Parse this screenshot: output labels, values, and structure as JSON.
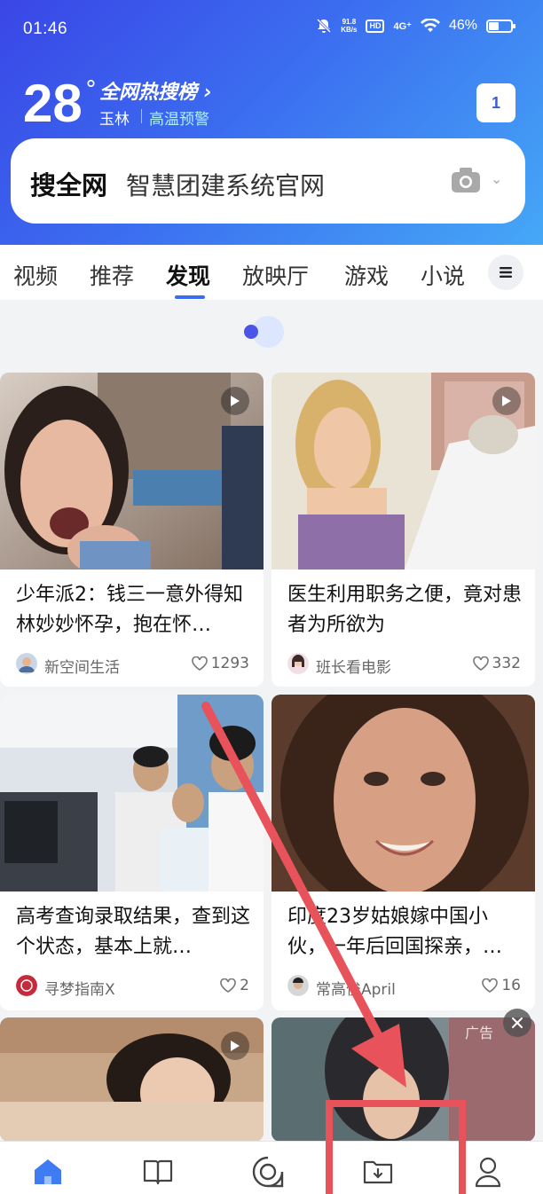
{
  "status_bar": {
    "time": "01:46",
    "net_speed_value": "91.8",
    "net_speed_unit": "KB/s",
    "hd": "HD",
    "signal": "4G⁺",
    "battery": "46%",
    "battery_level": 0.46
  },
  "header": {
    "temperature": "28",
    "degree": "°",
    "hot_list": "全网热搜榜 ›",
    "city": "玉林",
    "alert": "高温预警",
    "tab_count": "1"
  },
  "search": {
    "brand": "搜全网",
    "query": "智慧团建系统官网"
  },
  "tabs": [
    {
      "label": "视频"
    },
    {
      "label": "推荐"
    },
    {
      "label": "发现"
    },
    {
      "label": "放映厅"
    },
    {
      "label": "游戏"
    },
    {
      "label": "小说"
    }
  ],
  "active_tab": "发现",
  "cards": [
    {
      "title": "少年派2：钱三一意外得知林妙妙怀孕，抱在怀…",
      "author": "新空间生活",
      "likes": "1293"
    },
    {
      "title": "医生利用职务之便，竟对患者为所欲为",
      "author": "班长看电影",
      "likes": "332"
    },
    {
      "title": "高考查询录取结果，查到这个状态，基本上就…",
      "author": "寻梦指南X",
      "likes": "2"
    },
    {
      "title": "印度23岁姑娘嫁中国小伙，一年后回国探亲，…",
      "author": "常高俊April",
      "likes": "16"
    }
  ],
  "ad_label": "广告",
  "bottom_nav": [
    {
      "icon": "home-icon"
    },
    {
      "icon": "book-icon"
    },
    {
      "icon": "discover-icon"
    },
    {
      "icon": "download-folder-icon"
    },
    {
      "icon": "profile-icon"
    }
  ],
  "colors": {
    "accent": "#3b6df0",
    "annotation": "#e8535b"
  }
}
